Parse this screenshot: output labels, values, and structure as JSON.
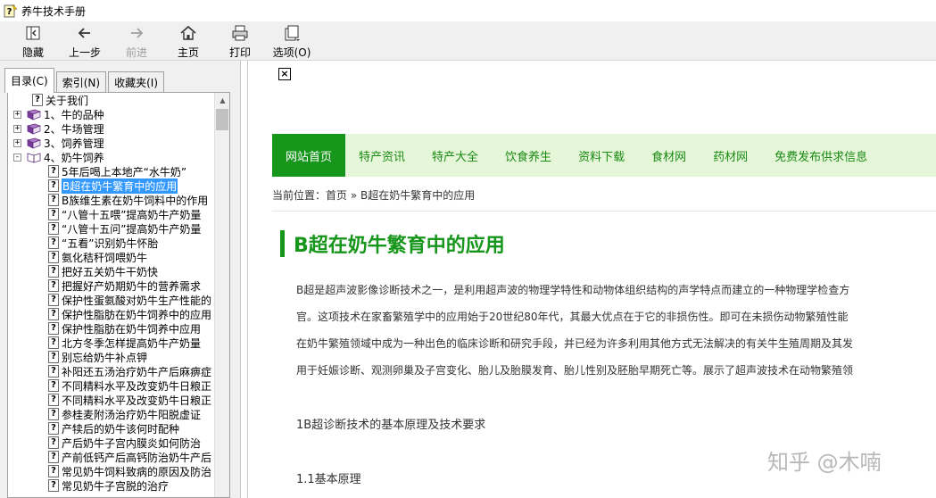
{
  "window": {
    "title": "养牛技术手册"
  },
  "toolbar": {
    "buttons": [
      {
        "label": "隐藏",
        "icon": "hide-icon",
        "enabled": true
      },
      {
        "label": "上一步",
        "icon": "back-arrow-icon",
        "enabled": true
      },
      {
        "label": "前进",
        "icon": "forward-arrow-icon",
        "enabled": false
      },
      {
        "label": "主页",
        "icon": "home-icon",
        "enabled": true
      },
      {
        "label": "打印",
        "icon": "printer-icon",
        "enabled": true
      },
      {
        "label": "选项(O)",
        "icon": "options-icon",
        "enabled": true
      }
    ]
  },
  "left_pane": {
    "tabs": [
      {
        "label": "目录(C)",
        "active": true
      },
      {
        "label": "索引(N)",
        "active": false
      },
      {
        "label": "收藏夹(I)",
        "active": false
      }
    ],
    "tree": [
      {
        "label": "关于我们",
        "type": "page",
        "level": 0
      },
      {
        "label": "1、牛的品种",
        "type": "book",
        "level": 0,
        "expander": "+"
      },
      {
        "label": "2、牛场管理",
        "type": "book",
        "level": 0,
        "expander": "+"
      },
      {
        "label": "3、饲养管理",
        "type": "book",
        "level": 0,
        "expander": "+"
      },
      {
        "label": "4、奶牛饲养",
        "type": "book-open",
        "level": 0,
        "expander": "-"
      },
      {
        "label": "5年后喝上本地产“水牛奶”",
        "type": "page",
        "level": 1
      },
      {
        "label": "B超在奶牛繁育中的应用",
        "type": "page",
        "level": 1,
        "selected": true
      },
      {
        "label": "B族维生素在奶牛饲料中的作用",
        "type": "page",
        "level": 1
      },
      {
        "label": "“八管十五喂”提高奶牛产奶量",
        "type": "page",
        "level": 1
      },
      {
        "label": "“八管十五问”提高奶牛产奶量",
        "type": "page",
        "level": 1
      },
      {
        "label": "“五看”识别奶牛怀胎",
        "type": "page",
        "level": 1
      },
      {
        "label": "氨化秸秆饲喂奶牛",
        "type": "page",
        "level": 1
      },
      {
        "label": "把好五关奶牛干奶快",
        "type": "page",
        "level": 1
      },
      {
        "label": "把握好产奶期奶牛的营养需求",
        "type": "page",
        "level": 1
      },
      {
        "label": "保护性蛋氨酸对奶牛生产性能的",
        "type": "page",
        "level": 1
      },
      {
        "label": "保护性脂肪在奶牛饲养中的应用",
        "type": "page",
        "level": 1
      },
      {
        "label": "保护性脂肪在奶牛饲养中应用",
        "type": "page",
        "level": 1
      },
      {
        "label": "北方冬季怎样提高奶牛产奶量",
        "type": "page",
        "level": 1
      },
      {
        "label": "别忘给奶牛补点钾",
        "type": "page",
        "level": 1
      },
      {
        "label": "补阳还五汤治疗奶牛产后麻痹症",
        "type": "page",
        "level": 1
      },
      {
        "label": "不同精料水平及改变奶牛日粮正",
        "type": "page",
        "level": 1
      },
      {
        "label": "不同精料水平及改变奶牛日粮正",
        "type": "page",
        "level": 1
      },
      {
        "label": "参桂麦附汤治疗奶牛阳脱虚证",
        "type": "page",
        "level": 1
      },
      {
        "label": "产犊后的奶牛该何时配种",
        "type": "page",
        "level": 1
      },
      {
        "label": "产后奶牛子宫内膜炎如何防治",
        "type": "page",
        "level": 1
      },
      {
        "label": "产前低钙产后高钙防治奶牛产后",
        "type": "page",
        "level": 1
      },
      {
        "label": "常见奶牛饲料致病的原因及防治",
        "type": "page",
        "level": 1
      },
      {
        "label": "常见奶牛子宫脱的治疗",
        "type": "page",
        "level": 1
      }
    ]
  },
  "content": {
    "nav": [
      {
        "label": "网站首页",
        "active": true
      },
      {
        "label": "特产资讯",
        "active": false
      },
      {
        "label": "特产大全",
        "active": false
      },
      {
        "label": "饮食养生",
        "active": false
      },
      {
        "label": "资料下载",
        "active": false
      },
      {
        "label": "食材网",
        "active": false
      },
      {
        "label": "药材网",
        "active": false
      },
      {
        "label": "免费发布供求信息",
        "active": false
      }
    ],
    "breadcrumb": "当前位置：首页 » B超在奶牛繁育中的应用",
    "title": "B超在奶牛繁育中的应用",
    "paragraph_lines": [
      "B超是超声波影像诊断技术之一，是利用超声波的物理学特性和动物体组织结构的声学特点而建立的一种物理学检查方",
      "官。这项技术在家畜繁殖学中的应用始于20世纪80年代，其最大优点在于它的非损伤性。即可在未损伤动物繁殖性能",
      "在奶牛繁殖领域中成为一种出色的临床诊断和研究手段，并已经为许多利用其他方式无法解决的有关牛生殖周期及其发",
      "用于妊娠诊断、观测卵巢及子宫变化、胎儿及胎膜发育、胎儿性别及胚胎早期死亡等。展示了超声波技术在动物繁殖领"
    ],
    "section1": "1B超诊断技术的基本原理及技术要求",
    "section1_1": "1.1基本原理"
  },
  "watermark": "知乎 @木喃"
}
